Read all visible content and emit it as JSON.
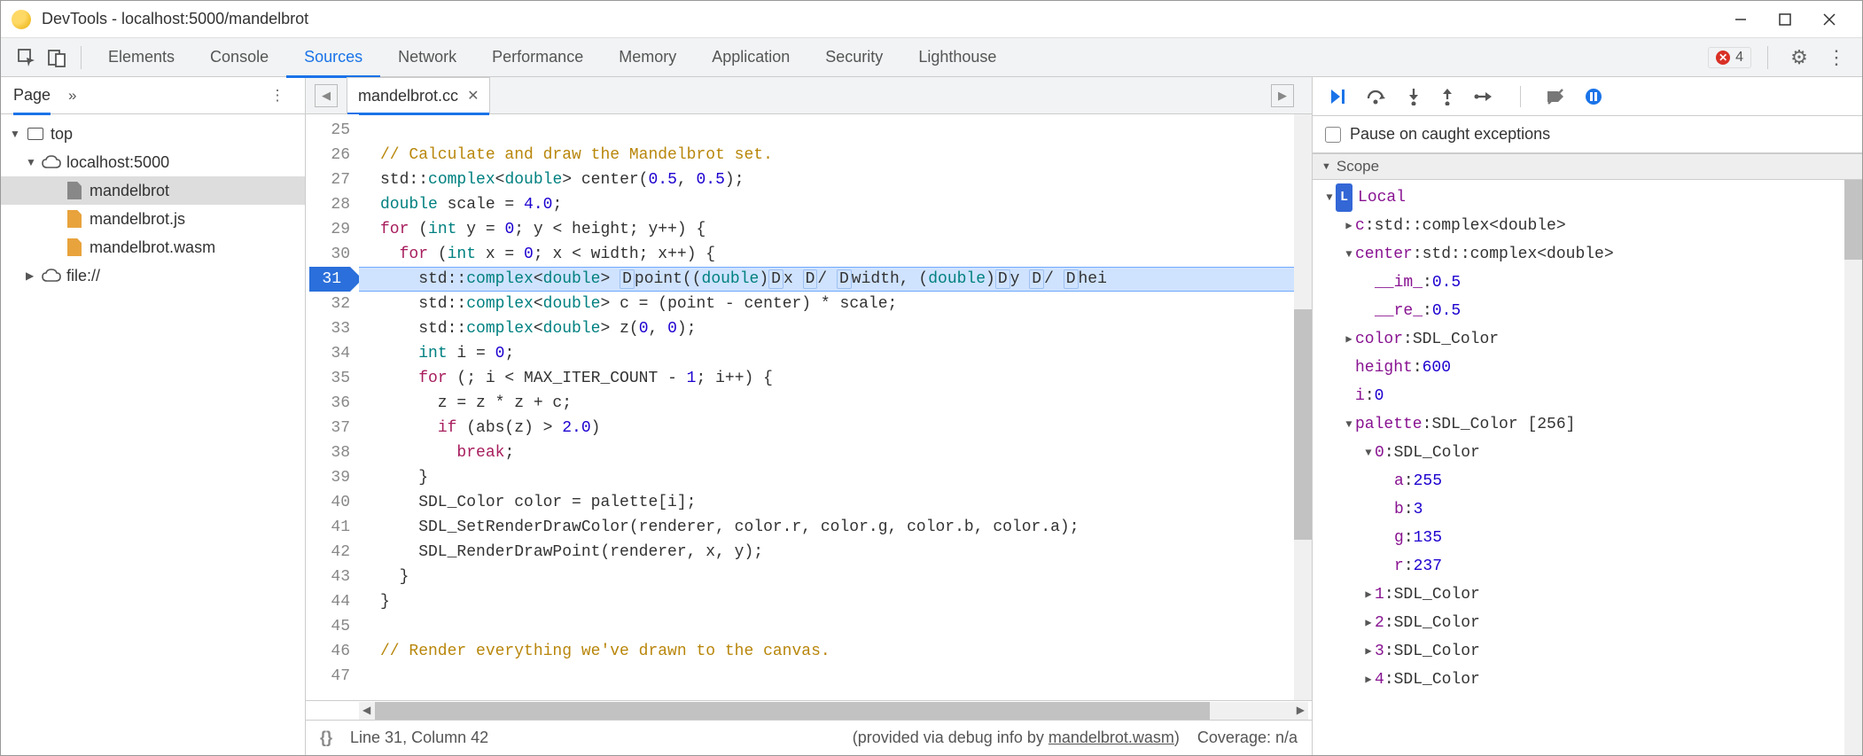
{
  "window": {
    "title": "DevTools - localhost:5000/mandelbrot"
  },
  "tabs": {
    "items": [
      "Elements",
      "Console",
      "Sources",
      "Network",
      "Performance",
      "Memory",
      "Application",
      "Security",
      "Lighthouse"
    ],
    "active_index": 2,
    "error_count": "4"
  },
  "sidebar": {
    "tab": "Page",
    "tree": {
      "top": "top",
      "host": "localhost:5000",
      "files": [
        "mandelbrot",
        "mandelbrot.js",
        "mandelbrot.wasm"
      ],
      "file_proto": "file://"
    }
  },
  "editor": {
    "tab_name": "mandelbrot.cc",
    "lines": [
      {
        "n": 25,
        "html": ""
      },
      {
        "n": 26,
        "html": "<span class='cm'>// Calculate and draw the Mandelbrot set.</span>"
      },
      {
        "n": 27,
        "html": "std::<span class='ty'>complex</span>&lt;<span class='ty'>double</span>&gt; center(<span class='nm'>0.5</span>, <span class='nm'>0.5</span>);"
      },
      {
        "n": 28,
        "html": "<span class='ty'>double</span> scale = <span class='nm'>4.0</span>;"
      },
      {
        "n": 29,
        "html": "<span class='kw'>for</span> (<span class='ty'>int</span> y = <span class='nm'>0</span>; y &lt; height; y++) {"
      },
      {
        "n": 30,
        "html": "  <span class='kw'>for</span> (<span class='ty'>int</span> x = <span class='nm'>0</span>; x &lt; width; x++) {"
      },
      {
        "n": 31,
        "html": "    std::<span class='ty'>complex</span>&lt;<span class='ty'>double</span>&gt; <span class='chip'>D</span>point((<span class='ty'>double</span>)<span class='chip'>D</span>x <span class='chip'>D</span>/ <span class='chip'>D</span>width, (<span class='ty'>double</span>)<span class='chip'>D</span>y <span class='chip'>D</span>/ <span class='chip'>D</span>hei",
        "bp": true
      },
      {
        "n": 32,
        "html": "    std::<span class='ty'>complex</span>&lt;<span class='ty'>double</span>&gt; c = (point - center) * scale;"
      },
      {
        "n": 33,
        "html": "    std::<span class='ty'>complex</span>&lt;<span class='ty'>double</span>&gt; z(<span class='nm'>0</span>, <span class='nm'>0</span>);"
      },
      {
        "n": 34,
        "html": "    <span class='ty'>int</span> i = <span class='nm'>0</span>;"
      },
      {
        "n": 35,
        "html": "    <span class='kw'>for</span> (; i &lt; MAX_ITER_COUNT - <span class='nm'>1</span>; i++) {"
      },
      {
        "n": 36,
        "html": "      z = z * z + c;"
      },
      {
        "n": 37,
        "html": "      <span class='kw'>if</span> (abs(z) &gt; <span class='nm'>2.0</span>)"
      },
      {
        "n": 38,
        "html": "        <span class='kw'>break</span>;"
      },
      {
        "n": 39,
        "html": "    }"
      },
      {
        "n": 40,
        "html": "    SDL_Color color = palette[i];"
      },
      {
        "n": 41,
        "html": "    SDL_SetRenderDrawColor(renderer, color.r, color.g, color.b, color.a);"
      },
      {
        "n": 42,
        "html": "    SDL_RenderDrawPoint(renderer, x, y);"
      },
      {
        "n": 43,
        "html": "  }"
      },
      {
        "n": 44,
        "html": "}"
      },
      {
        "n": 45,
        "html": ""
      },
      {
        "n": 46,
        "html": "<span class='cm'>// Render everything we've drawn to the canvas.</span>"
      },
      {
        "n": 47,
        "html": ""
      }
    ],
    "status": {
      "pos": "Line 31, Column 42",
      "provided_prefix": "(provided via debug info by ",
      "provided_link": "mandelbrot.wasm",
      "provided_suffix": ")",
      "coverage": "Coverage: n/a"
    }
  },
  "debugger": {
    "pause_caught": "Pause on caught exceptions",
    "scope_label": "Scope",
    "scope": [
      {
        "d": 0,
        "t": "open",
        "badge": "L",
        "k": "Local",
        "v": ""
      },
      {
        "d": 1,
        "t": "closed",
        "k": "c",
        "v": "std::complex<double>"
      },
      {
        "d": 1,
        "t": "open",
        "k": "center",
        "v": "std::complex<double>"
      },
      {
        "d": 2,
        "t": "none",
        "k": "__im_",
        "v": "0.5",
        "num": true
      },
      {
        "d": 2,
        "t": "none",
        "k": "__re_",
        "v": "0.5",
        "num": true
      },
      {
        "d": 1,
        "t": "closed",
        "k": "color",
        "v": "SDL_Color"
      },
      {
        "d": 1,
        "t": "none",
        "k": "height",
        "v": "600",
        "num": true
      },
      {
        "d": 1,
        "t": "none",
        "k": "i",
        "v": "0",
        "num": true
      },
      {
        "d": 1,
        "t": "open",
        "k": "palette",
        "v": "SDL_Color [256]"
      },
      {
        "d": 2,
        "t": "open",
        "k": "0",
        "v": "SDL_Color"
      },
      {
        "d": 3,
        "t": "none",
        "k": "a",
        "v": "255",
        "num": true
      },
      {
        "d": 3,
        "t": "none",
        "k": "b",
        "v": "3",
        "num": true
      },
      {
        "d": 3,
        "t": "none",
        "k": "g",
        "v": "135",
        "num": true
      },
      {
        "d": 3,
        "t": "none",
        "k": "r",
        "v": "237",
        "num": true
      },
      {
        "d": 2,
        "t": "closed",
        "k": "1",
        "v": "SDL_Color"
      },
      {
        "d": 2,
        "t": "closed",
        "k": "2",
        "v": "SDL_Color"
      },
      {
        "d": 2,
        "t": "closed",
        "k": "3",
        "v": "SDL_Color"
      },
      {
        "d": 2,
        "t": "closed",
        "k": "4",
        "v": "SDL_Color"
      }
    ]
  }
}
